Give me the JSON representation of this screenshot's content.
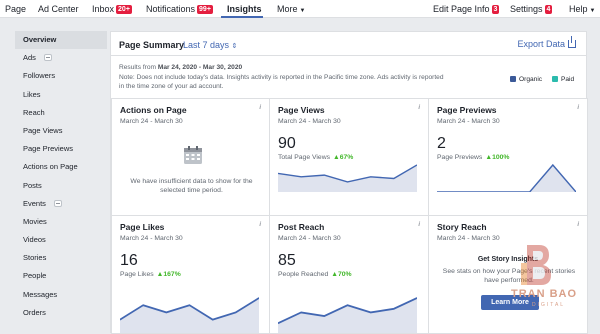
{
  "topbar": {
    "page": "Page",
    "ad_center": "Ad Center",
    "inbox": "Inbox",
    "inbox_badge": "20+",
    "notifications": "Notifications",
    "notifications_badge": "99+",
    "insights": "Insights",
    "more": "More",
    "edit_page_info": "Edit Page Info",
    "edit_badge": "3",
    "settings": "Settings",
    "settings_badge": "4",
    "help": "Help"
  },
  "sidebar": {
    "items": [
      "Overview",
      "Ads",
      "Followers",
      "Likes",
      "Reach",
      "Page Views",
      "Page Previews",
      "Actions on Page",
      "Posts",
      "Events",
      "Movies",
      "Videos",
      "Stories",
      "People",
      "Messages",
      "Orders"
    ],
    "active": "Overview"
  },
  "summary": {
    "title": "Page Summary",
    "range": "Last 7 days",
    "export": "Export Data",
    "results_prefix": "Results from ",
    "results_dates": "Mar 24, 2020 - Mar 30, 2020",
    "note_line1": "Note: Does not include today's data. Insights activity is reported in the Pacific time zone. Ads activity is reported",
    "note_line2": "in the time zone of your ad account.",
    "legend": [
      {
        "label": "Organic",
        "color": "#3b5998"
      },
      {
        "label": "Paid",
        "color": "#2bbbad"
      }
    ]
  },
  "cards": {
    "actions": {
      "title": "Actions on Page",
      "date": "March 24 - March 30",
      "message": "We have insufficient data to show for the selected time period."
    },
    "views": {
      "title": "Page Views",
      "date": "March 24 - March 30",
      "value": "90",
      "metric": "Total Page Views",
      "change": "▲67%",
      "spark": [
        11,
        9,
        10,
        6,
        9,
        8,
        16
      ]
    },
    "previews": {
      "title": "Page Previews",
      "date": "March 24 - March 30",
      "value": "2",
      "metric": "Page Previews",
      "change": "▲100%",
      "spark": [
        0,
        0,
        0,
        0,
        0,
        2,
        0
      ]
    },
    "likes": {
      "title": "Page Likes",
      "date": "March 24 - March 30",
      "value": "16",
      "metric": "Page Likes",
      "change": "▲167%",
      "spark": [
        2,
        4,
        3,
        4,
        2,
        3,
        5
      ]
    },
    "reach": {
      "title": "Post Reach",
      "date": "March 24 - March 30",
      "value": "85",
      "metric": "People Reached",
      "change": "▲70%",
      "spark": [
        3,
        6,
        5,
        8,
        6,
        7,
        10
      ]
    },
    "story": {
      "title": "Story Reach",
      "date": "March 24 - March 30",
      "cta_title": "Get Story Insights",
      "cta_desc": "See stats on how your Page's recent stories have performed.",
      "button": "Learn More"
    }
  },
  "accent": "#4267b2",
  "watermark": {
    "line1": "TRAN BAO",
    "line2": "DIGITAL"
  }
}
